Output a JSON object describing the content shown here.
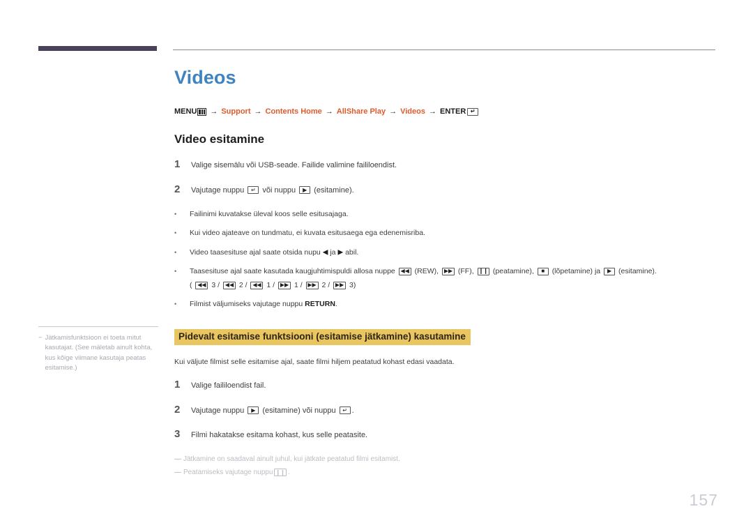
{
  "page": {
    "number": "157",
    "title": "Videos"
  },
  "menu_path": {
    "menu_label": "MENU",
    "menu_icon": "menu-grid-icon",
    "crumbs": [
      "Support",
      "Contents Home",
      "AllShare Play",
      "Videos"
    ],
    "arrow": "→",
    "enter_label": "ENTER",
    "enter_icon": "enter-return-icon"
  },
  "section": {
    "title": "Video esitamine",
    "steps": [
      {
        "num": "1",
        "text": "Valige sisemälu või USB-seade. Failide valimine faililoendist."
      },
      {
        "num": "2",
        "text_before": "Vajutage nuppu",
        "icon1": "enter-return-icon",
        "text_middle": "või nuppu",
        "icon2": "play-icon",
        "text_after": "(esitamine)."
      }
    ],
    "bullets": [
      {
        "text": "Failinimi kuvatakse üleval koos selle esitusajaga."
      },
      {
        "text": "Kui video ajateave on tundmatu, ei kuvata esitusaega ega edenemisriba."
      },
      {
        "text_before": "Video taasesituse ajal saate otsida nupu",
        "icon1": "left-triangle-icon",
        "text_middle": "ja",
        "icon2": "right-triangle-icon",
        "text_after": "abil."
      },
      {
        "text_before": "Taasesituse ajal saate kasutada kaugjuhtimispuldi allosa nuppe",
        "rew_icon": "rewind-icon",
        "rew_label": "(REW),",
        "ff_icon": "fastforward-icon",
        "ff_label": "(FF),",
        "pause_icon": "pause-icon",
        "pause_label": "(peatamine),",
        "stop_icon": "stop-icon",
        "stop_label": "(lõpetamine) ja",
        "play_icon": "play-icon",
        "play_label": "(esitamine).",
        "sequence_open": "(",
        "sequence": [
          {
            "icon": "rewind-icon",
            "label": "3 /"
          },
          {
            "icon": "rewind-icon",
            "label": "2 /"
          },
          {
            "icon": "rewind-icon",
            "label": "1 /"
          },
          {
            "icon": "fastforward-icon",
            "label": "1 /"
          },
          {
            "icon": "fastforward-icon",
            "label": "2 /"
          },
          {
            "icon": "fastforward-icon",
            "label": "3)"
          }
        ]
      },
      {
        "text_before": "Filmist väljumiseks vajutage nuppu",
        "bold_key": "RETURN",
        "text_after": "."
      }
    ]
  },
  "resume_section": {
    "heading": "Pidevalt esitamise funktsiooni (esitamise jätkamine) kasutamine",
    "lead": "Kui väljute filmist selle esitamise ajal, saate filmi hiljem peatatud kohast edasi vaadata.",
    "steps": [
      {
        "num": "1",
        "text": "Valige faililoendist fail."
      },
      {
        "num": "2",
        "text_before": "Vajutage nuppu",
        "icon1": "play-icon",
        "text_middle": "(esitamine) või nuppu",
        "icon2": "enter-return-icon",
        "text_after": "."
      },
      {
        "num": "3",
        "text": "Filmi hakatakse esitama kohast, kus selle peatasite."
      }
    ],
    "footnotes": [
      {
        "dash": "—",
        "text": "Jätkamine on saadaval ainult juhul, kui jätkate peatatud filmi esitamist."
      },
      {
        "dash": "—",
        "text_before": "Peatamiseks vajutage nuppu",
        "icon": "pause-icon",
        "text_after": "."
      }
    ]
  },
  "sidenote": {
    "dash": "−",
    "text": "Jätkamisfunktsioon ei toeta mitut kasutajat. (See mäletab ainult kohta, kus kõige viimane kasutaja peatas esitamise.)"
  },
  "colors": {
    "title_blue": "#3f83c0",
    "crumb_orange": "#e05a2b",
    "highlight_gold": "#e9c65f",
    "corner_bar": "#4a4258",
    "page_number": "#c9ccd4"
  }
}
